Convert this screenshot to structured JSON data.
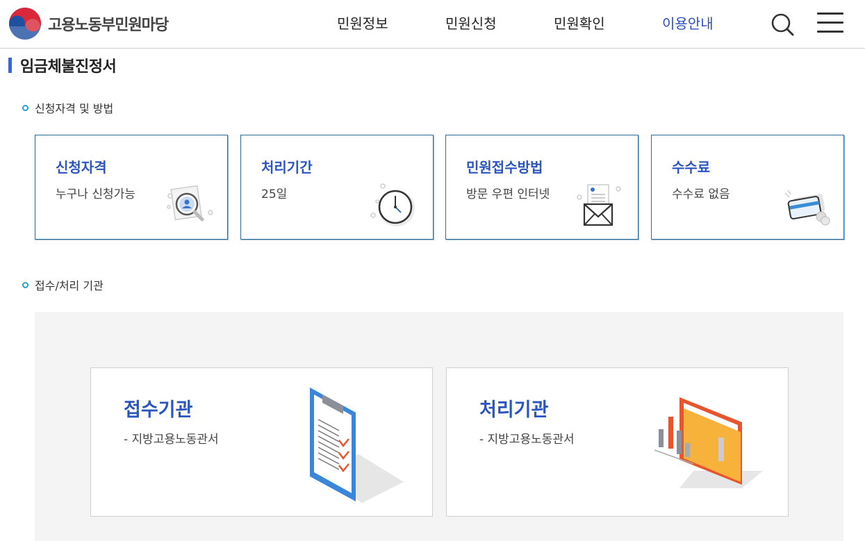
{
  "header": {
    "logo_text": "고용노동부민원마당",
    "nav": [
      "민원정보",
      "민원신청",
      "민원확인",
      "이용안내"
    ],
    "active_nav": "이용안내",
    "accent_color": "#2a4fc4"
  },
  "page": {
    "title": "임금체불진정서"
  },
  "section1": {
    "label": "신청자격 및 방법",
    "cards": [
      {
        "title": "신청자격",
        "value": "누구나 신청가능",
        "icon": "magnifier-user-icon"
      },
      {
        "title": "처리기간",
        "value": "25일",
        "icon": "clock-icon"
      },
      {
        "title": "민원접수방법",
        "value": "방문  우편  인터넷",
        "icon": "envelope-icon"
      },
      {
        "title": "수수료",
        "value": "수수료 없음",
        "icon": "card-coin-icon"
      }
    ]
  },
  "section2": {
    "label": "접수/처리 기관",
    "orgs": [
      {
        "title": "접수기관",
        "value": "-  지방고용노동관서",
        "icon": "clipboard-icon"
      },
      {
        "title": "처리기관",
        "value": "-  지방고용노동관서",
        "icon": "folder-chart-icon"
      }
    ]
  },
  "colors": {
    "title_blue": "#2a54c0",
    "card_border": "#2e6e9c",
    "dot": "#27a0c8",
    "area_bg": "#f4f4f4"
  }
}
